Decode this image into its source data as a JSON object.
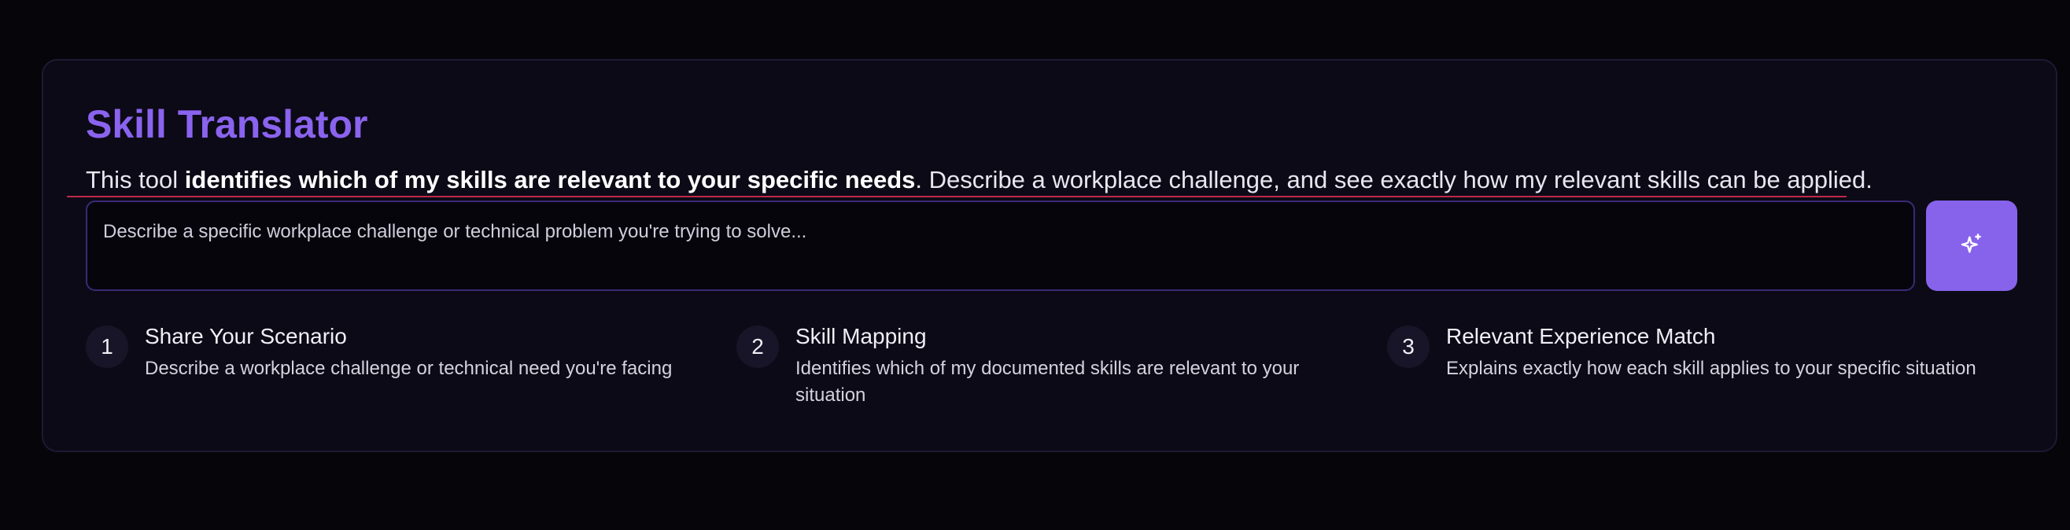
{
  "header": {
    "title": "Skill Translator",
    "intro_prefix": "This tool ",
    "intro_bold": "identifies which of my skills are relevant to your specific needs",
    "intro_suffix": ". Describe a workplace challenge, and see exactly how my relevant skills can be applied."
  },
  "scenario_input": {
    "placeholder": "Describe a specific workplace challenge or technical problem you're trying to solve...",
    "value": ""
  },
  "submit_button": {
    "icon": "sparkles-icon",
    "color": "#8763ec"
  },
  "steps": [
    {
      "number": "1",
      "title": "Share Your Scenario",
      "description": "Describe a workplace challenge or technical need you're facing"
    },
    {
      "number": "2",
      "title": "Skill Mapping",
      "description": "Identifies which of my documented skills are relevant to your situation"
    },
    {
      "number": "3",
      "title": "Relevant Experience Match",
      "description": "Explains exactly how each skill applies to your specific situation"
    }
  ],
  "colors": {
    "accent": "#8a63ee",
    "background": "#06050a",
    "card": "#0c0a16",
    "highlight_line": "#c0284a"
  }
}
